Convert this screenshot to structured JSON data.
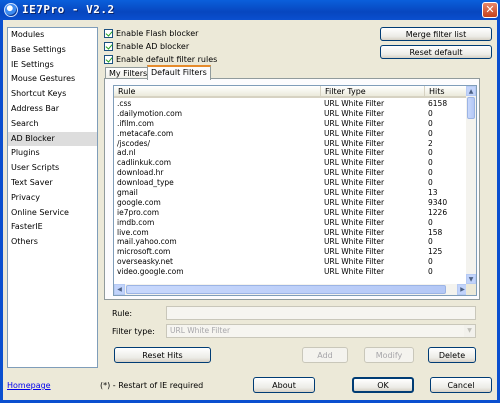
{
  "window": {
    "title": "IE7Pro - V2.2",
    "close_label": "✕"
  },
  "sidebar": {
    "items": [
      {
        "label": "Modules",
        "name": "modules"
      },
      {
        "label": "Base Settings",
        "name": "base-settings"
      },
      {
        "label": "IE Settings",
        "name": "ie-settings"
      },
      {
        "label": "Mouse Gestures",
        "name": "mouse-gestures"
      },
      {
        "label": "Shortcut Keys",
        "name": "shortcut-keys"
      },
      {
        "label": "Address Bar",
        "name": "address-bar"
      },
      {
        "label": "Search",
        "name": "search"
      },
      {
        "label": "AD Blocker",
        "name": "ad-blocker",
        "selected": true
      },
      {
        "label": "Plugins",
        "name": "plugins"
      },
      {
        "label": "User Scripts",
        "name": "user-scripts"
      },
      {
        "label": "Text Saver",
        "name": "text-saver"
      },
      {
        "label": "Privacy",
        "name": "privacy"
      },
      {
        "label": "Online Service",
        "name": "online-service"
      },
      {
        "label": "FasterIE",
        "name": "fasterie"
      },
      {
        "label": "Others",
        "name": "others"
      }
    ]
  },
  "options": {
    "flash": "Enable Flash blocker",
    "ad": "Enable AD blocker",
    "default_rules": "Enable default filter rules"
  },
  "buttons": {
    "merge": "Merge filter list",
    "reset_default": "Reset default",
    "reset_hits": "Reset Hits",
    "add": "Add",
    "modify": "Modify",
    "delete": "Delete",
    "about": "About",
    "ok": "OK",
    "cancel": "Cancel"
  },
  "tabs": {
    "my_filters": "My Filters",
    "default_filters": "Default Filters"
  },
  "table": {
    "headers": {
      "rule": "Rule",
      "type": "Filter Type",
      "hits": "Hits"
    },
    "rows": [
      {
        "rule": ".css",
        "type": "URL White Filter",
        "hits": "6158"
      },
      {
        "rule": ".dailymotion.com",
        "type": "URL White Filter",
        "hits": "0"
      },
      {
        "rule": ".ifilm.com",
        "type": "URL White Filter",
        "hits": "0"
      },
      {
        "rule": ".metacafe.com",
        "type": "URL White Filter",
        "hits": "0"
      },
      {
        "rule": "/jscodes/",
        "type": "URL White Filter",
        "hits": "2"
      },
      {
        "rule": "ad.nl",
        "type": "URL White Filter",
        "hits": "0"
      },
      {
        "rule": "cadlinkuk.com",
        "type": "URL White Filter",
        "hits": "0"
      },
      {
        "rule": "download.hr",
        "type": "URL White Filter",
        "hits": "0"
      },
      {
        "rule": "download_type",
        "type": "URL White Filter",
        "hits": "0"
      },
      {
        "rule": "gmail",
        "type": "URL White Filter",
        "hits": "13"
      },
      {
        "rule": "google.com",
        "type": "URL White Filter",
        "hits": "9340"
      },
      {
        "rule": "ie7pro.com",
        "type": "URL White Filter",
        "hits": "1226"
      },
      {
        "rule": "imdb.com",
        "type": "URL White Filter",
        "hits": "0"
      },
      {
        "rule": "live.com",
        "type": "URL White Filter",
        "hits": "158"
      },
      {
        "rule": "mail.yahoo.com",
        "type": "URL White Filter",
        "hits": "0"
      },
      {
        "rule": "microsoft.com",
        "type": "URL White Filter",
        "hits": "125"
      },
      {
        "rule": "overseasky.net",
        "type": "URL White Filter",
        "hits": "0"
      },
      {
        "rule": "video.google.com",
        "type": "URL White Filter",
        "hits": "0"
      }
    ]
  },
  "form": {
    "rule_label": "Rule:",
    "rule_value": "",
    "filter_type_label": "Filter type:",
    "filter_type_value": "URL White Filter"
  },
  "footer": {
    "homepage": "Homepage",
    "note": "(*) - Restart of IE required"
  }
}
